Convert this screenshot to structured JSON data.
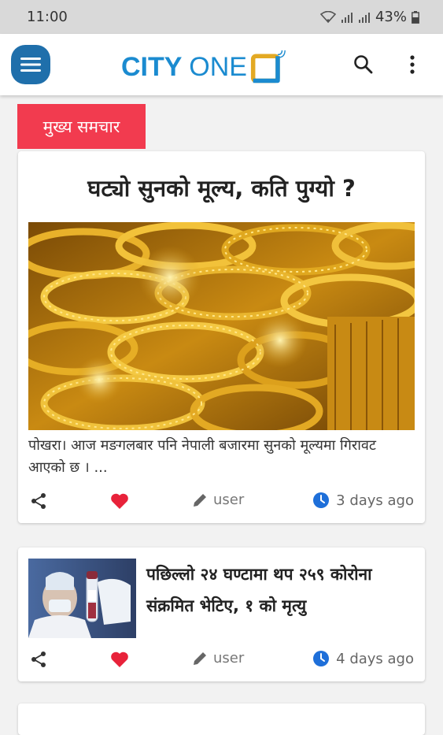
{
  "status_bar": {
    "time": "11:00",
    "battery": "43%"
  },
  "app": {
    "logo_bold": "CITY",
    "logo_light": "ONE"
  },
  "icons": {
    "menu": "hamburger-menu-icon",
    "search": "search-icon",
    "more": "more-vertical-icon",
    "share": "share-icon",
    "like": "heart-icon",
    "author": "pencil-icon",
    "time": "clock-icon"
  },
  "colors": {
    "brand": "#1b8bd0",
    "menu_button": "#1f6fab",
    "section_tag": "#f23b4f",
    "heart": "#e8223a",
    "clock": "#1e6fd9"
  },
  "section": {
    "title": "मुख्य समचार"
  },
  "featured": {
    "title": "घट्यो सुनको मूल्य, कति पुग्यो ?",
    "excerpt": "पोखरा। आज मङगलबार पनि नेपाली बजारमा सुनको मूल्यमा गिरावट आएको छ । ...",
    "author": "user",
    "time_ago": "3 days ago"
  },
  "articles": [
    {
      "title": "पछिल्लो २४ घण्टामा थप २५९ कोरोना संक्रमित भेटिए, १ को मृत्यु",
      "author": "user",
      "time_ago": "4 days ago"
    }
  ]
}
